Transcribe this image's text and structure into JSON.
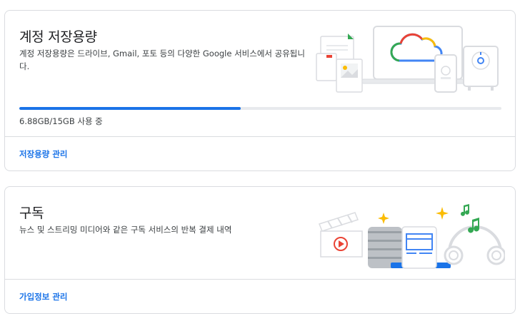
{
  "storage": {
    "title": "계정 저장용량",
    "description": "계정 저장용량은 드라이브, Gmail, 포토 등의 다양한 Google 서비스에서 공유됩니다.",
    "usage_text": "6.88GB/15GB 사용 중",
    "used_fraction": 0.4587,
    "manage_link": "저장용량 관리",
    "illustration_icon": "cloud-devices-illustration"
  },
  "subscriptions": {
    "title": "구독",
    "description": "뉴스 및 스트리밍 미디어와 같은 구독 서비스의 반복 결제 내역",
    "manage_link": "가입정보 관리",
    "illustration_icon": "subscriptions-media-illustration"
  },
  "colors": {
    "accent": "#1a73e8",
    "track": "#e8eaed",
    "border": "#dadce0",
    "google_red": "#ea4335",
    "google_yellow": "#fbbc04",
    "google_green": "#34a853",
    "google_blue": "#4285f4"
  }
}
